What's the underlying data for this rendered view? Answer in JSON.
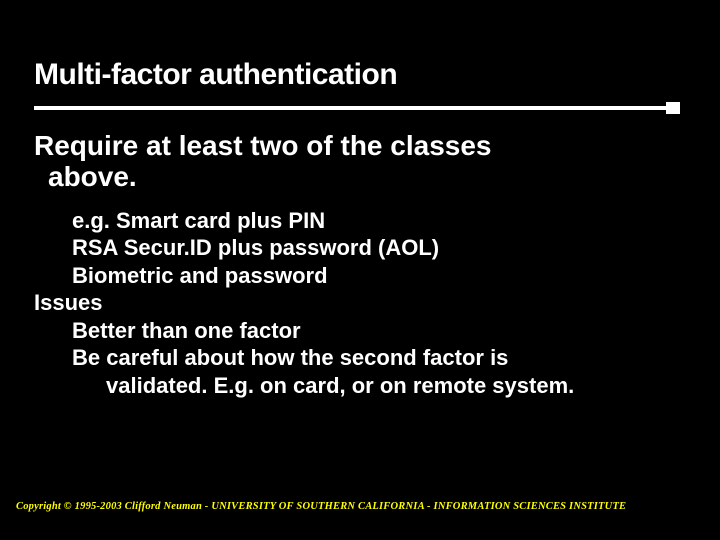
{
  "title": "Multi-factor authentication",
  "lead": {
    "line1": "Require at least two of the classes",
    "line2": "above."
  },
  "items": {
    "eg_smart": "e.g. Smart card plus PIN",
    "rsa": "RSA Secur.ID plus password (AOL)",
    "biometric": "Biometric and password",
    "issues": "Issues",
    "better": "Better than one factor",
    "careful1": "Be careful about how the second factor is",
    "careful2": "validated.   E.g. on card, or on remote system."
  },
  "footer": "Copyright © 1995-2003 Clifford Neuman - UNIVERSITY OF SOUTHERN CALIFORNIA - INFORMATION SCIENCES INSTITUTE"
}
